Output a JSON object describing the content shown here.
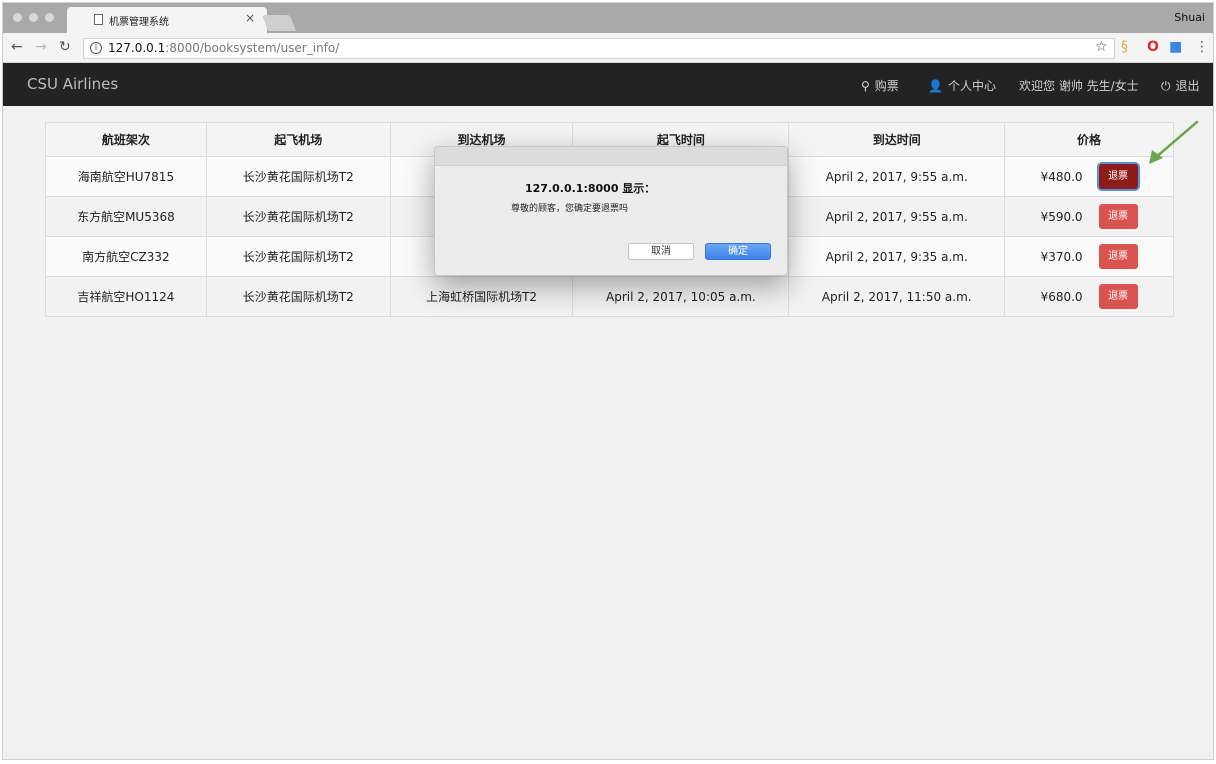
{
  "browser": {
    "tab_title": "机票管理系统",
    "tab_close": "×",
    "profile": "Shuai",
    "url_host": "127.0.0.1",
    "url_rest": ":8000/booksystem/user_info/"
  },
  "navbar": {
    "brand": "CSU Airlines",
    "buy": "购票",
    "profile": "个人中心",
    "welcome": "欢迎您 谢帅 先生/女士",
    "logout": "退出"
  },
  "table": {
    "headers": [
      "航班架次",
      "起飞机场",
      "到达机场",
      "起飞时间",
      "到达时间",
      "价格"
    ],
    "rows": [
      {
        "flight": "海南航空HU7815",
        "from": "长沙黄花国际机场T2",
        "to": "",
        "depart": "",
        "arrive": "April 2, 2017, 9:55 a.m.",
        "price": "¥480.0",
        "action": "退票"
      },
      {
        "flight": "东方航空MU5368",
        "from": "长沙黄花国际机场T2",
        "to": "",
        "depart": "",
        "arrive": "April 2, 2017, 9:55 a.m.",
        "price": "¥590.0",
        "action": "退票"
      },
      {
        "flight": "南方航空CZ332",
        "from": "长沙黄花国际机场T2",
        "to": "",
        "depart": "",
        "arrive": "April 2, 2017, 9:35 a.m.",
        "price": "¥370.0",
        "action": "退票"
      },
      {
        "flight": "吉祥航空HO1124",
        "from": "长沙黄花国际机场T2",
        "to": "上海虹桥国际机场T2",
        "depart": "April 2, 2017, 10:05 a.m.",
        "arrive": "April 2, 2017, 11:50 a.m.",
        "price": "¥680.0",
        "action": "退票"
      }
    ]
  },
  "dialog": {
    "title": "127.0.0.1:8000 显示：",
    "message": "尊敬的顾客，您确定要退票吗",
    "cancel": "取消",
    "ok": "确定"
  },
  "colors": {
    "navbar": "#232323",
    "refund": "#d9534f",
    "refund_active": "#8c1c1a",
    "ok_button": "#3d82ea",
    "arrow": "#6aa84f"
  },
  "icons": {
    "buy": "search-icon",
    "profile": "user-icon",
    "logout": "power-icon"
  }
}
